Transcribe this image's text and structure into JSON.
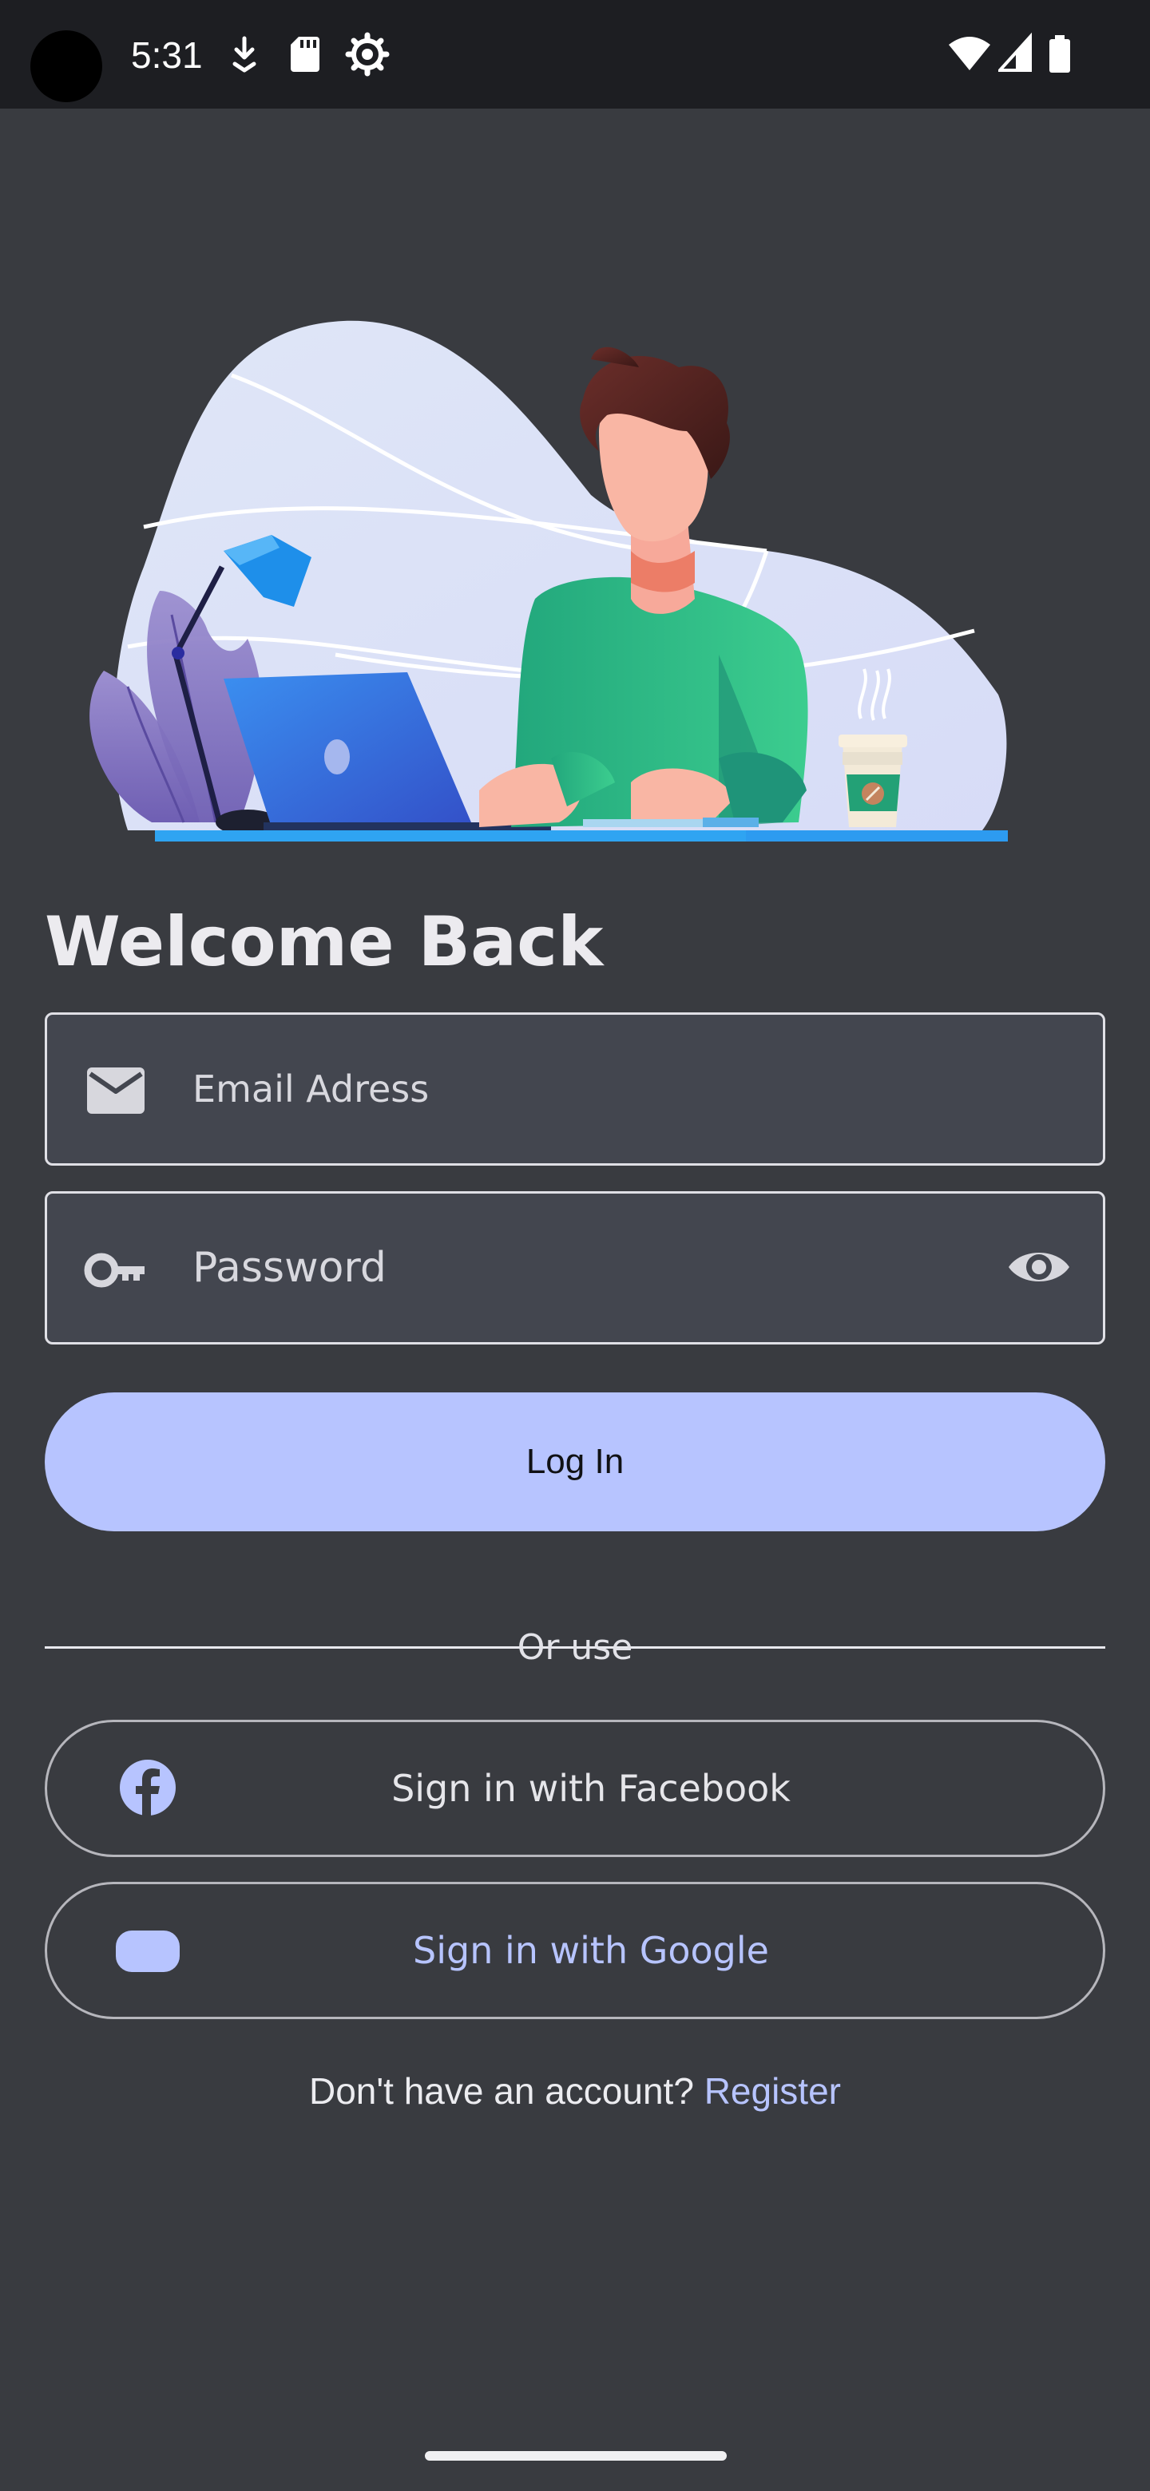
{
  "status_bar": {
    "time": "5:31",
    "left_icons": [
      "download-icon",
      "sd-card-icon",
      "settings-icon"
    ],
    "right_icons": [
      "wifi-icon",
      "cellular-signal-icon",
      "battery-icon"
    ]
  },
  "illustration": {
    "subject": "person-working-at-laptop-illustration"
  },
  "login": {
    "title": "Welcome Back",
    "email": {
      "placeholder": "Email Adress",
      "icon": "mail-icon"
    },
    "password": {
      "placeholder": "Password",
      "icon": "key-icon",
      "toggle_icon": "eye-icon"
    },
    "login_button": "Log In",
    "divider_text": "Or use"
  },
  "social": {
    "facebook": {
      "label": "Sign in with Facebook",
      "icon": "facebook-icon",
      "label_color": "#e6e6ea"
    },
    "google": {
      "label": "Sign in with Google",
      "icon": "google-icon",
      "label_color": "#b7c4ff"
    }
  },
  "register": {
    "prompt": "Don't have an account?",
    "link": "Register"
  },
  "colors": {
    "background": "#393b40",
    "status_bar": "#1d1e22",
    "accent": "#b7c4ff",
    "input_background": "#43464f"
  }
}
